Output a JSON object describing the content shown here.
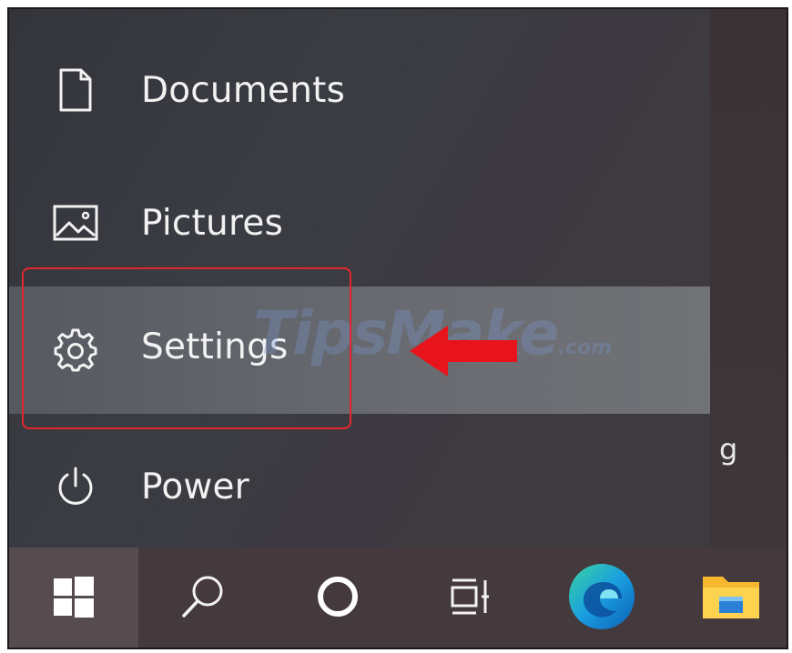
{
  "start_menu": {
    "items": [
      {
        "label": "Documents",
        "icon": "document-icon"
      },
      {
        "label": "Pictures",
        "icon": "pictures-icon"
      },
      {
        "label": "Settings",
        "icon": "gear-icon",
        "highlighted": true
      },
      {
        "label": "Power",
        "icon": "power-icon"
      }
    ],
    "partial_text": "g"
  },
  "watermark": {
    "main": "TipsMake",
    "suffix": ".com"
  },
  "taskbar": {
    "buttons": [
      {
        "name": "start",
        "icon": "windows-logo-icon"
      },
      {
        "name": "search",
        "icon": "search-icon"
      },
      {
        "name": "cortana",
        "icon": "cortana-icon"
      },
      {
        "name": "task-view",
        "icon": "task-view-icon"
      },
      {
        "name": "edge",
        "icon": "edge-icon"
      },
      {
        "name": "file-explorer",
        "icon": "folder-icon"
      }
    ]
  },
  "colors": {
    "highlight": "#e3262d",
    "arrow": "#e8141b"
  }
}
